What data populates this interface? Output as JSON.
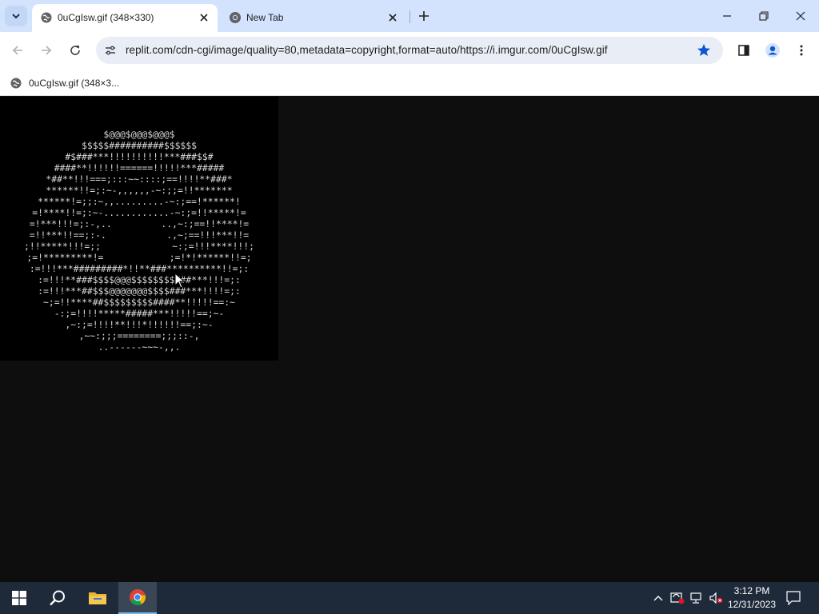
{
  "browser": {
    "tabs": [
      {
        "title": "0uCgIsw.gif (348×330)",
        "active": true
      },
      {
        "title": "New Tab",
        "active": false
      }
    ],
    "url": "replit.com/cdn-cgi/image/quality=80,metadata=copyright,format=auto/https://i.imgur.com/0uCgIsw.gif",
    "bookmarks": [
      {
        "label": "0uCgIsw.gif (348×3..."
      }
    ],
    "bookmark_star_color": "#0b57d0",
    "accent_color": "#d3e3fd"
  },
  "page": {
    "image_alt_icon": "ascii-art-gif",
    "ascii_art": [
      "$@@@$@@@$@@@$",
      "$$$$$##########$$$$$$",
      "#$###***!!!!!!!!!!***###$$#",
      "####**!!!!!!======!!!!!***#####",
      "*##**!!!===;:::~~::::;==!!!!**###*",
      "******!!=;:~-,,,,,,-~:;;=!!*******",
      "******!=;;:~,,.........-~:;==!******!",
      "=!****!!=;:~-............-~:;=!!*****!=",
      "=!***!!!=;:-,..         ..,~:;==!!****!=",
      "=!!***!!==;:-.           .,~;==!!!***!!=",
      ";!!*****!!!=;;             ~:;=!!!****!!!;",
      ";=!*********!=            ;=!*!******!!=;",
      ":=!!!***#########*!!**###**********!!=;:",
      ":=!!!**###$$$$@@@$$$$$$$$###***!!!=;:",
      ":=!!!***##$$$@@@@@@@$$$$###***!!!!=;:",
      "~;=!!****##$$$$$$$$$####**!!!!!==:~",
      "-:;=!!!!*****#####***!!!!!==;~-",
      ",~:;=!!!!**!!!*!!!!!!==;:~-",
      ",~~:;;;========;;;::-,",
      "..------~~~-,,."
    ]
  },
  "taskbar": {
    "time": "3:12 PM",
    "date": "12/31/2023",
    "apps": [
      "start-button",
      "search",
      "file-explorer",
      "chrome"
    ]
  }
}
